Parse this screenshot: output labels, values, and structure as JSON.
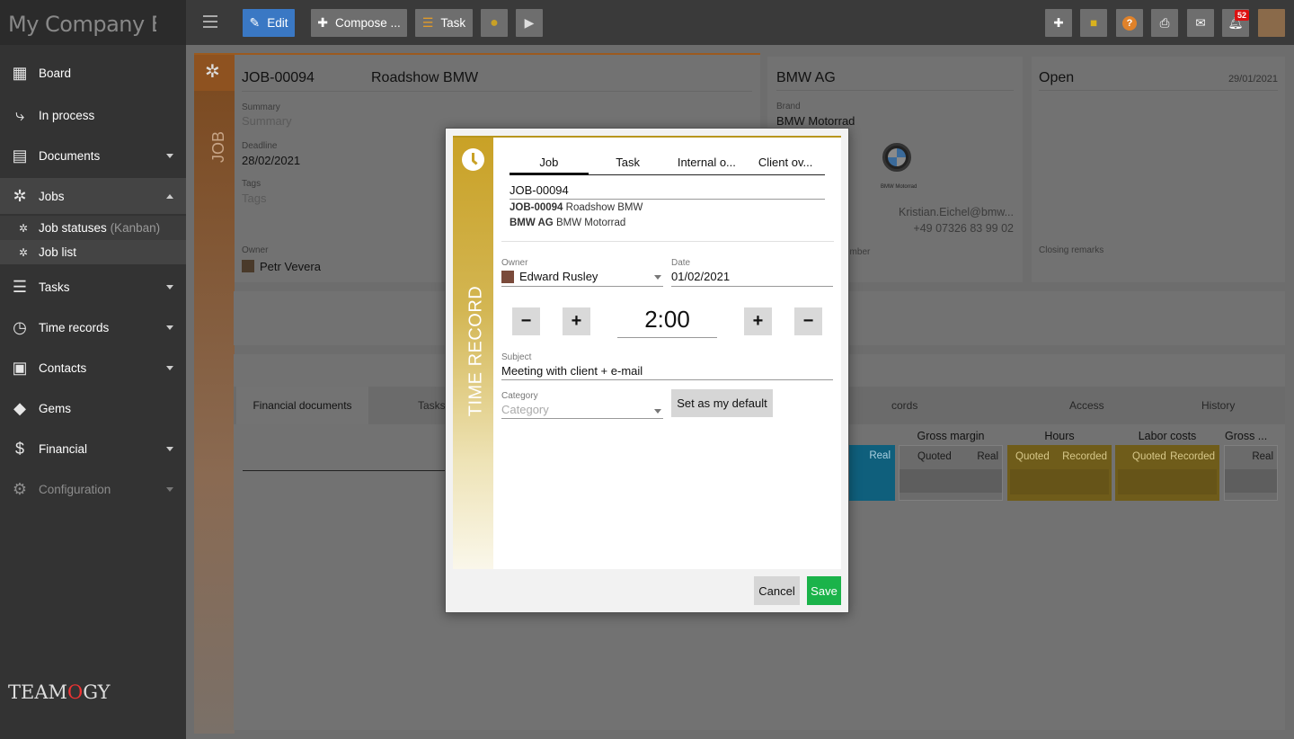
{
  "app": {
    "title": "My Company El"
  },
  "colors": {
    "accent_job": "#b86a2a",
    "accent_time": "#c9a126",
    "save": "#1bb34a",
    "edit": "#3a78c4",
    "cyan": "#16a4d6"
  },
  "sidebar": {
    "items": [
      {
        "label": "Board",
        "icon": "grid-icon"
      },
      {
        "label": "In process",
        "icon": "flow-icon"
      },
      {
        "label": "Documents",
        "icon": "document-icon"
      },
      {
        "label": "Jobs",
        "icon": "gear-icon"
      },
      {
        "label": "Job statuses",
        "label_suffix": "(Kanban)",
        "icon": "gear-small-icon"
      },
      {
        "label": "Job list",
        "icon": "gear-small-icon"
      },
      {
        "label": "Tasks",
        "icon": "tasks-icon"
      },
      {
        "label": "Time records",
        "icon": "clock-icon"
      },
      {
        "label": "Contacts",
        "icon": "contact-icon"
      },
      {
        "label": "Gems",
        "icon": "gem-icon"
      },
      {
        "label": "Financial",
        "icon": "dollar-icon"
      },
      {
        "label": "Configuration",
        "icon": "cog-icon"
      }
    ],
    "logo_text": "TEAM",
    "logo_o": "O",
    "logo_end": "GY"
  },
  "toolbar": {
    "edit": "Edit",
    "compose": "Compose ...",
    "task": "Task",
    "notification_count": "52"
  },
  "job": {
    "side_label": "JOB",
    "number": "JOB-00094",
    "name": "Roadshow BMW",
    "summary_label": "Summary",
    "summary_placeholder": "Summary",
    "deadline_label": "Deadline",
    "deadline": "28/02/2021",
    "tags_label": "Tags",
    "tags_placeholder": "Tags",
    "owner_label": "Owner",
    "owner": "Petr Vevera"
  },
  "client": {
    "name": "BMW AG",
    "brand_label": "Brand",
    "brand": "BMW Motorrad",
    "logo_caption": "BMW Motorrad",
    "email": "Kristian.Eichel@bmw...",
    "phone": "+49 07326 83 99 02",
    "member_text": "ember"
  },
  "status": {
    "label": "Open",
    "date": "29/01/2021",
    "closing_label": "Closing remarks"
  },
  "tabs_bottom": [
    "Financial documents",
    "Tasks",
    "cords",
    "Access",
    "History"
  ],
  "fin_columns": [
    {
      "title": "",
      "sub": [
        "Real"
      ]
    },
    {
      "title": "Gross margin",
      "sub": [
        "Quoted",
        "Real"
      ]
    },
    {
      "title": "Hours",
      "sub": [
        "Quoted",
        "Recorded"
      ]
    },
    {
      "title": "Labor costs",
      "sub": [
        "Quoted",
        "Recorded"
      ]
    },
    {
      "title": "Gross ...",
      "sub": [
        "Real"
      ]
    }
  ],
  "dialog": {
    "side_label": "TIME RECORD",
    "tabs": [
      "Job",
      "Task",
      "Internal o...",
      "Client ov..."
    ],
    "job_value": "JOB-00094",
    "line1_bold": "JOB-00094",
    "line1_text": "Roadshow BMW",
    "line2_bold": "BMW AG",
    "line2_text": "BMW Motorrad",
    "owner_label": "Owner",
    "owner": "Edward Rusley",
    "date_label": "Date",
    "date": "01/02/2021",
    "duration": "2:00",
    "minus": "−",
    "plus": "+",
    "subject_label": "Subject",
    "subject": "Meeting with client + e-mail",
    "category_label": "Category",
    "category_placeholder": "Category",
    "set_default": "Set as my default",
    "cancel": "Cancel",
    "save": "Save"
  }
}
